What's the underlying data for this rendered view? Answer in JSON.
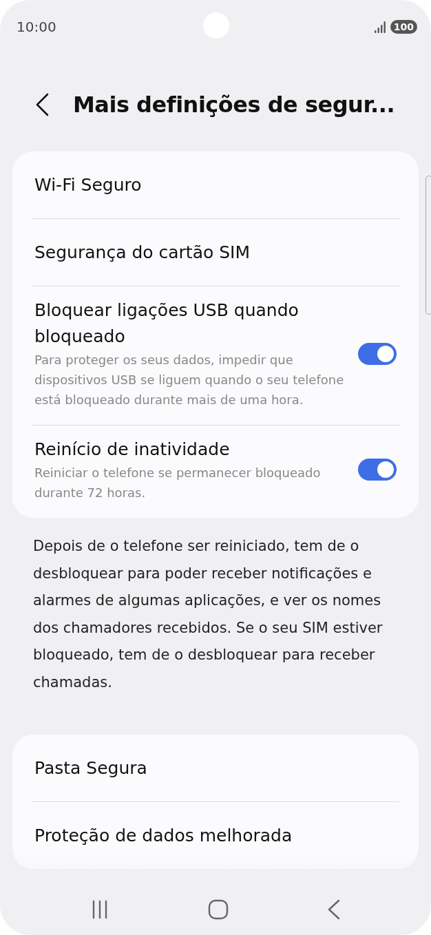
{
  "status_bar": {
    "time": "10:00",
    "battery": "100"
  },
  "header": {
    "title": "Mais definições de segur..."
  },
  "sections": [
    {
      "kind": "card",
      "items": [
        {
          "kind": "link",
          "title": "Wi-Fi Seguro"
        },
        {
          "kind": "link",
          "title": "Segurança do cartão SIM"
        },
        {
          "kind": "toggle",
          "title": "Bloquear ligações USB quando bloqueado",
          "description": "Para proteger os seus dados, impedir que dispositivos USB se liguem quando o seu telefone está bloqueado durante mais de uma hora.",
          "on": true
        },
        {
          "kind": "toggle",
          "title": "Reinício de inatividade",
          "description": "Reiniciar o telefone se permanecer bloqueado durante 72 horas.",
          "on": true
        }
      ]
    },
    {
      "kind": "note",
      "text": "Depois de o telefone ser reiniciado, tem de o desbloquear para poder receber notificações e alarmes de algumas aplicações, e ver os nomes dos chamadores recebidos. Se o seu SIM estiver bloqueado, tem de o desbloquear para receber chamadas."
    },
    {
      "kind": "card",
      "items": [
        {
          "kind": "link",
          "title": "Pasta Segura"
        },
        {
          "kind": "link",
          "title": "Proteção de dados melhorada"
        }
      ]
    }
  ]
}
